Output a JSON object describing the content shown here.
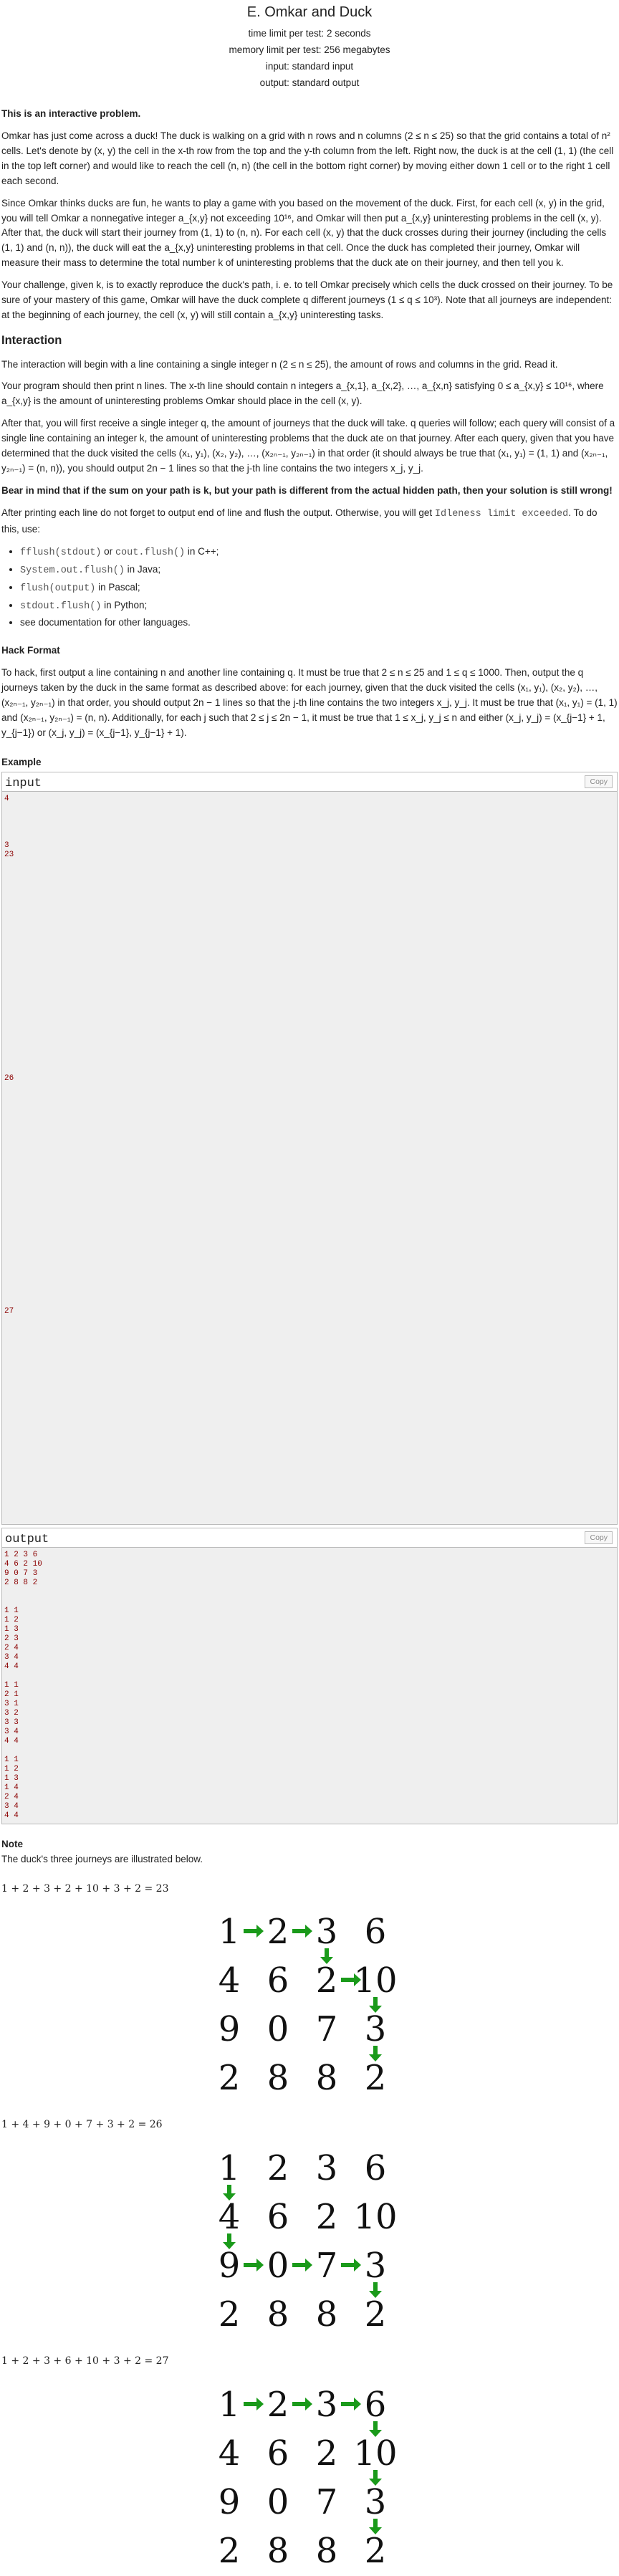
{
  "header": {
    "title": "E. Omkar and Duck",
    "time_limit": "time limit per test: 2 seconds",
    "memory_limit": "memory limit per test: 256 megabytes",
    "input": "input: standard input",
    "output": "output: standard output"
  },
  "statement": {
    "interactive": "This is an interactive problem.",
    "p1": "Omkar has just come across a duck! The duck is walking on a grid with n rows and n columns (2 ≤ n ≤ 25) so that the grid contains a total of n² cells. Let's denote by (x, y) the cell in the x-th row from the top and the y-th column from the left. Right now, the duck is at the cell (1, 1) (the cell in the top left corner) and would like to reach the cell (n, n) (the cell in the bottom right corner) by moving either down 1 cell or to the right 1 cell each second.",
    "p2": "Since Omkar thinks ducks are fun, he wants to play a game with you based on the movement of the duck. First, for each cell (x, y) in the grid, you will tell Omkar a nonnegative integer a_{x,y} not exceeding 10¹⁶, and Omkar will then put a_{x,y} uninteresting problems in the cell (x, y). After that, the duck will start their journey from (1, 1) to (n, n). For each cell (x, y) that the duck crosses during their journey (including the cells (1, 1) and (n, n)), the duck will eat the a_{x,y} uninteresting problems in that cell. Once the duck has completed their journey, Omkar will measure their mass to determine the total number k of uninteresting problems that the duck ate on their journey, and then tell you k.",
    "p3": "Your challenge, given k, is to exactly reproduce the duck's path, i. e. to tell Omkar precisely which cells the duck crossed on their journey. To be sure of your mastery of this game, Omkar will have the duck complete q different journeys (1 ≤ q ≤ 10³). Note that all journeys are independent: at the beginning of each journey, the cell (x, y) will still contain a_{x,y} uninteresting tasks."
  },
  "interaction": {
    "title": "Interaction",
    "p1": "The interaction will begin with a line containing a single integer n (2 ≤ n ≤ 25), the amount of rows and columns in the grid. Read it.",
    "p2": "Your program should then print n lines. The x-th line should contain n integers a_{x,1}, a_{x,2}, …, a_{x,n} satisfying 0 ≤ a_{x,y} ≤ 10¹⁶, where a_{x,y} is the amount of uninteresting problems Omkar should place in the cell (x, y).",
    "p3": "After that, you will first receive a single integer q, the amount of journeys that the duck will take. q queries will follow; each query will consist of a single line containing an integer k, the amount of uninteresting problems that the duck ate on that journey. After each query, given that you have determined that the duck visited the cells (x₁, y₁), (x₂, y₂), …, (x₂ₙ₋₁, y₂ₙ₋₁) in that order (it should always be true that (x₁, y₁) = (1, 1) and (x₂ₙ₋₁, y₂ₙ₋₁) = (n, n)), you should output 2n − 1 lines so that the j-th line contains the two integers x_j, y_j.",
    "warning": "Bear in mind that if the sum on your path is k, but your path is different from the actual hidden path, then your solution is still wrong!",
    "flush_pre": "After printing each line do not forget to output end of line and flush the output. Otherwise, you will get",
    "flush_code": "Idleness limit exceeded",
    "flush_post": ". To do this, use:",
    "flush_items": [
      {
        "code": "fflush(stdout)",
        "mid": " or ",
        "code2": "cout.flush()",
        "text": " in C++;"
      },
      {
        "code": "System.out.flush()",
        "mid": "",
        "code2": "",
        "text": " in Java;"
      },
      {
        "code": "flush(output)",
        "mid": "",
        "code2": "",
        "text": " in Pascal;"
      },
      {
        "code": "stdout.flush()",
        "mid": "",
        "code2": "",
        "text": " in Python;"
      },
      {
        "code": "",
        "mid": "",
        "code2": "",
        "text": "see documentation for other languages."
      }
    ]
  },
  "hack": {
    "title": "Hack Format",
    "p1": "To hack, first output a line containing n and another line containing q. It must be true that 2 ≤ n ≤ 25 and 1 ≤ q ≤ 1000. Then, output the q journeys taken by the duck in the same format as described above: for each journey, given that the duck visited the cells (x₁, y₁), (x₂, y₂), …, (x₂ₙ₋₁, y₂ₙ₋₁) in that order, you should output 2n − 1 lines so that the j-th line contains the two integers x_j, y_j. It must be true that (x₁, y₁) = (1, 1) and (x₂ₙ₋₁, y₂ₙ₋₁) = (n, n). Additionally, for each j such that 2 ≤ j ≤ 2n − 1, it must be true that 1 ≤ x_j, y_j ≤ n and either (x_j, y_j) = (x_{j−1} + 1, y_{j−1}) or (x_j, y_j) = (x_{j−1}, y_{j−1} + 1)."
  },
  "example": {
    "title": "Example",
    "input_label": "input",
    "output_label": "output",
    "copy_label": "Copy",
    "input_text": "4\n\n\n\n\n3\n23\n\n\n\n\n\n\n\n\n\n\n\n\n\n\n\n\n\n\n\n\n\n\n\n26\n\n\n\n\n\n\n\n\n\n\n\n\n\n\n\n\n\n\n\n\n\n\n\n\n27\n\n\n\n\n\n\n\n\n\n\n\n\n\n\n\n\n\n\n\n\n\n\n",
    "output_text": "1 2 3 6\n4 6 2 10\n9 0 7 3\n2 8 8 2\n\n\n1 1\n1 2\n1 3\n2 3\n2 4\n3 4\n4 4\n\n1 1\n2 1\n3 1\n3 2\n3 3\n3 4\n4 4\n\n1 1\n1 2\n1 3\n1 4\n2 4\n3 4\n4 4"
  },
  "note": {
    "title": "Note",
    "intro": "The duck's three journeys are illustrated below.",
    "grid": [
      [
        1,
        2,
        3,
        6
      ],
      [
        4,
        6,
        2,
        10
      ],
      [
        9,
        0,
        7,
        3
      ],
      [
        2,
        8,
        8,
        2
      ]
    ],
    "arrow_color": "#1a9a1a",
    "journeys": [
      {
        "sum": "1 + 2 + 3 + 2 + 10 + 3 + 2 = 23",
        "path": [
          [
            1,
            1
          ],
          [
            1,
            2
          ],
          [
            1,
            3
          ],
          [
            2,
            3
          ],
          [
            2,
            4
          ],
          [
            3,
            4
          ],
          [
            4,
            4
          ]
        ]
      },
      {
        "sum": "1 + 4 + 9 + 0 + 7 + 3 + 2 = 26",
        "path": [
          [
            1,
            1
          ],
          [
            2,
            1
          ],
          [
            3,
            1
          ],
          [
            3,
            2
          ],
          [
            3,
            3
          ],
          [
            3,
            4
          ],
          [
            4,
            4
          ]
        ]
      },
      {
        "sum": "1 + 2 + 3 + 6 + 10 + 3 + 2 = 27",
        "path": [
          [
            1,
            1
          ],
          [
            1,
            2
          ],
          [
            1,
            3
          ],
          [
            1,
            4
          ],
          [
            2,
            4
          ],
          [
            3,
            4
          ],
          [
            4,
            4
          ]
        ]
      }
    ]
  }
}
